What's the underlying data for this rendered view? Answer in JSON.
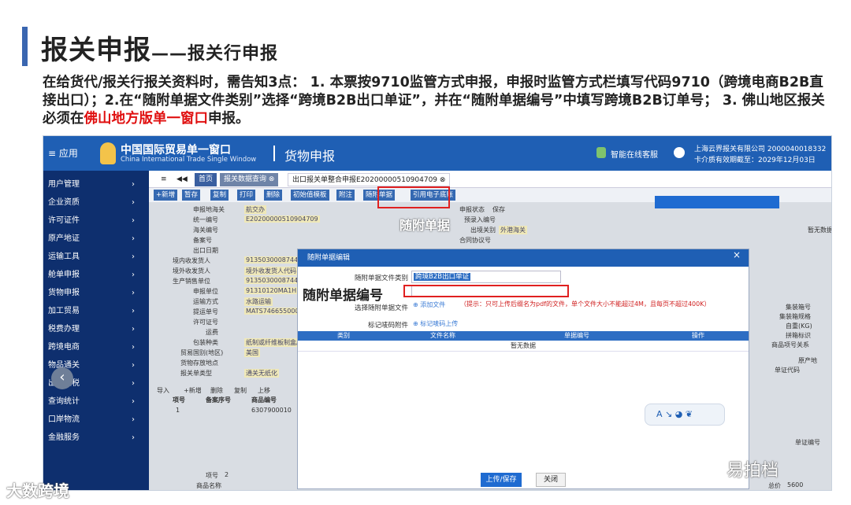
{
  "slide": {
    "title_main": "报关申报",
    "title_sub": "——报关行申报",
    "intro_part1": "在给货代/报关行报关资料时，需告知3点： 1. 本票按9710监管方式申报，申报时监管方式栏填写代码9710（跨境电商B2B直接出口）；2.在“随附单据文件类别”选择“跨境B2B出口单证”，并在“随附单据编号”中填写跨境B2B订单号； 3. 佛山地区报关必须在",
    "intro_red": "佛山地方版单一窗口",
    "intro_part2": "申报。"
  },
  "app": {
    "menu_label": "≡ 应用",
    "logo_cn": "中国国际贸易单一窗口",
    "logo_en": "China International Trade Single Window",
    "title": "货物申报",
    "service": "智能在线客服",
    "company": "上海云界报关有限公司 2000040018332",
    "card_expiry": "卡介质有效期截至：2029年12月03日"
  },
  "sidebar": [
    "用户管理",
    "企业资质",
    "许可证件",
    "原产地证",
    "运输工具",
    "舱单申报",
    "货物申报",
    "加工贸易",
    "税费办理",
    "跨境电商",
    "物品通关",
    "出口退税",
    "查询统计",
    "口岸物流",
    "金融服务"
  ],
  "tabs": [
    "≡",
    "◀◀",
    "首页",
    "报关数据查询 ⊗",
    "出口报关单整合申报E20200000510904709 ⊗"
  ],
  "toolbar": [
    "+新增",
    "暂存",
    "复制",
    "打印",
    "删除",
    "初始值模板",
    "附注",
    "随附单据",
    "引用电子底账"
  ],
  "form": {
    "rows": [
      {
        "label": "申报地海关",
        "value": "航交办"
      },
      {
        "label": "统一编号",
        "value": "E20200000510904709"
      },
      {
        "label": "海关编号",
        "value": ""
      },
      {
        "label": "备案号",
        "value": ""
      },
      {
        "label": "出口日期",
        "value": ""
      },
      {
        "label": "境内收发货人",
        "value": "9135030008744600Q"
      },
      {
        "label": "境外收发货人",
        "value": "境外收发货人代码"
      },
      {
        "label": "生产销售单位",
        "value": "9135030008744600Q"
      },
      {
        "label": "申报单位",
        "value": "91310120MA1HN4NR"
      },
      {
        "label": "运输方式",
        "value": "水路运输"
      },
      {
        "label": "提运单号",
        "value": "MATS746655000"
      },
      {
        "label": "许可证号",
        "value": ""
      },
      {
        "label": "运费",
        "value": ""
      },
      {
        "label": "包装种类",
        "value": "纸制或纤维板制盒/箱"
      },
      {
        "label": "贸易国别(地区)",
        "value": "美国"
      },
      {
        "label": "货物存放地点",
        "value": ""
      },
      {
        "label": "报关单类型",
        "value": "通关无纸化"
      }
    ],
    "right_rows": [
      {
        "label": "申报状态",
        "value": "保存"
      },
      {
        "label": "预录入编号",
        "value": ""
      },
      {
        "label": "出境关别",
        "value": "外港海关"
      },
      {
        "label": "合同协议号",
        "value": ""
      }
    ],
    "list_toolbar": [
      "导入",
      "+新增",
      "删除",
      "复制",
      "上移"
    ],
    "list_cols": [
      "项号",
      "备案序号",
      "商品编号"
    ],
    "list_row": {
      "no": "1",
      "code": "6307900010"
    },
    "right_panel": [
      "集装箱号",
      "集装箱规格",
      "自重(KG)",
      "拼箱标识",
      "商品项号关系",
      "原产地",
      "单证代码",
      "单证编号"
    ],
    "right_panel_status": "暂无数据",
    "bottom": {
      "item_no_label": "项号",
      "item_no": "2",
      "name_label": "商品名称",
      "amount_label": "总价",
      "amount": "5600"
    }
  },
  "callout_label": "随附单据",
  "dialog": {
    "title": "随附单据编辑",
    "close": "×",
    "category_label": "随附单据文件类别",
    "category_value": "跨境B2B出口单证",
    "number_big_label": "随附单据编号",
    "choose_label": "选择随附单据文件",
    "add_file": "添加文件",
    "hint": "（提示：只可上传后缀名为pdf的文件，单个文件大小不能超过4M，且每页不超过400K）",
    "mark_label": "标记唛码附件",
    "mark_link": "标记唛码上传",
    "cols": [
      "类别",
      "文件名称",
      "单据编号",
      "操作"
    ],
    "empty": "暂无数据",
    "pill": "A ↘ ◕ ❦",
    "upload": "上传/保存",
    "close_btn": "关闭"
  },
  "watermarks": {
    "left": "大数跨境",
    "right": "易拍档"
  }
}
